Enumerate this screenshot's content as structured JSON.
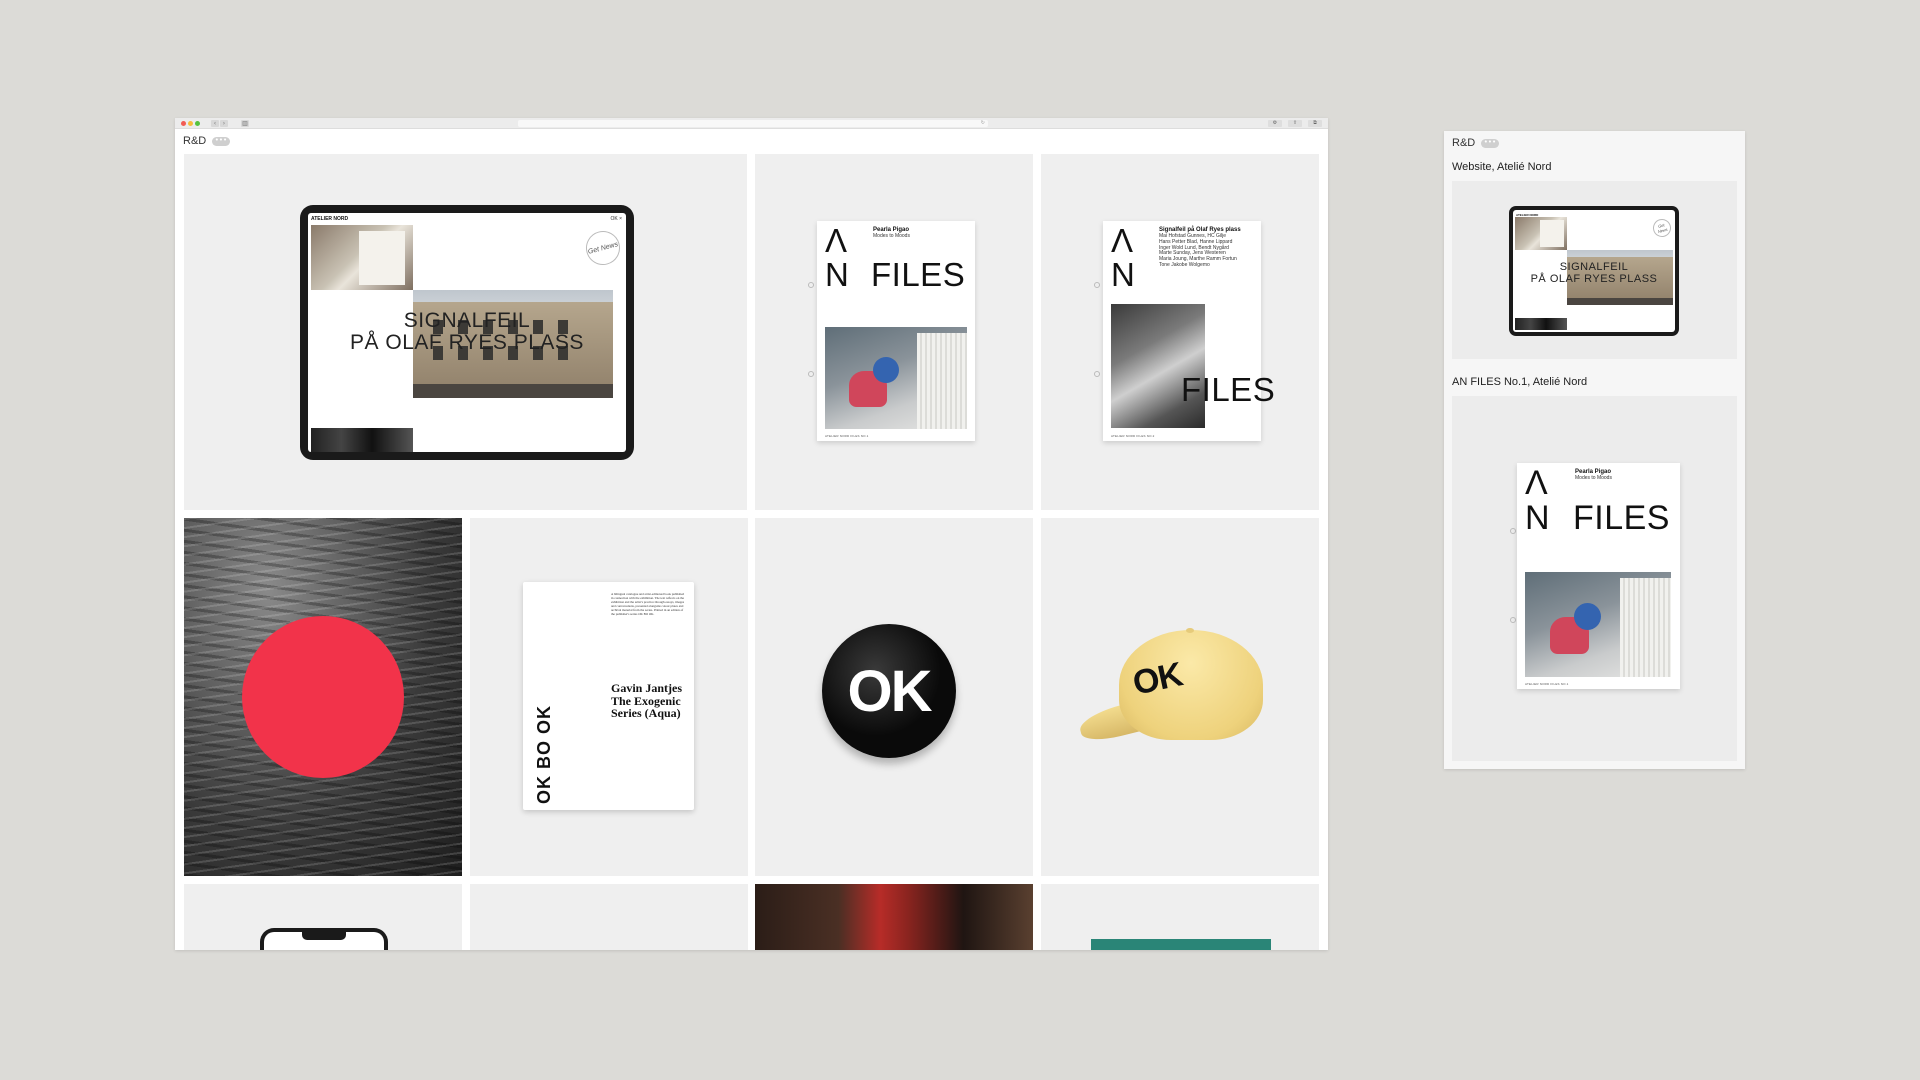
{
  "browser": {
    "nav_back": "‹",
    "nav_forward": "›",
    "sidebar_toggle": "▥",
    "address_icon": "↻",
    "right_buttons": [
      "⚙",
      "⇪",
      "⧉"
    ]
  },
  "page": {
    "brand": "R&D",
    "more_label": "•••"
  },
  "tiles": {
    "website": {
      "logo": "ATELIER NORD",
      "nav": "OK  ×",
      "title_line1": "SIGNALFEIL",
      "title_line2": "PÅ OLAF RYES PLASS",
      "badge": "Get News"
    },
    "an_files_1": {
      "mark_a": "Λ",
      "mark_n": "N",
      "files": "FILES",
      "head": "Pearla Pigao",
      "sub": "Modes to Moods",
      "footer": "ATELIER NORD FILES NO.1"
    },
    "an_files_2": {
      "mark_a": "Λ",
      "mark_n": "N",
      "files": "FILES",
      "head": "Signalfeil på Olaf Ryes plass",
      "sub_lines": [
        "Mai Hofstad Gunnes, HC Gilje",
        "Hans Petter Blad, Hanne Lippard",
        "Inger Wold Lund, Bendt Nygård",
        "Marte Sunday, Jens Westeren",
        "Maria Joung, Marthe Ramm Fortun",
        "Tone Jakobe Wolgemo"
      ],
      "footer": "ATELIER NORD FILES NO.2"
    },
    "book": {
      "spine": "OK BO OK",
      "title": "Gavin Jantjes The Exogenic Series (Aqua)",
      "body": "A bilingual catalogue and artist-editioned book published in connection with the exhibition. The text reflects on the exhibition and the artist's practice through essays, images and conversations, presented alongside colour plates and archival material from the series. Printed in an edition of the publisher's series OK BO OK."
    },
    "ok_button": {
      "label": "OK"
    },
    "cap": {
      "label": "OK"
    }
  },
  "panel": {
    "brand": "R&D",
    "more_label": "•••",
    "caption1": "Website, Atelié Nord",
    "caption2": "AN FILES No.1, Atelié Nord",
    "card1": {
      "title_line1": "SIGNALFEIL",
      "title_line2": "PÅ OLAF RYES PLASS",
      "badge": "Get News",
      "logo": "ATELIER NORD"
    },
    "card2": {
      "mark_a": "Λ",
      "mark_n": "N",
      "files": "FILES",
      "head": "Pearla Pigao",
      "sub": "Modes to Moods",
      "footer": "ATELIER NORD FILES NO.1"
    }
  },
  "colors": {
    "background": "#dcdbd7",
    "tile": "#efefef",
    "red_dot": "#f2334a",
    "cap_yellow": "#eed27c",
    "teal": "#2a8577"
  }
}
